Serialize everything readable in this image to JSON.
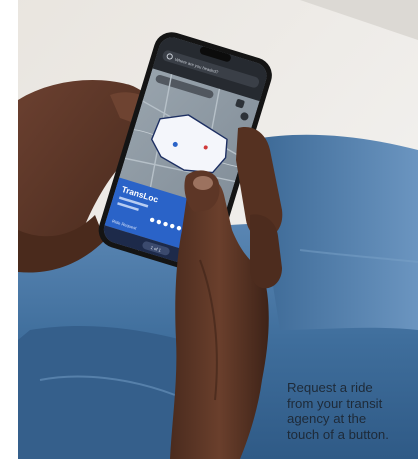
{
  "caption": {
    "line_1": "Request a ride",
    "line_2": "from your transit",
    "line_3": "agency at the",
    "line_4": "touch of a button."
  },
  "phone": {
    "brand_title": "TransLoc",
    "search_hint": "Where are you headed?",
    "footer_hint": "Ride Request",
    "pager": "1 of 1"
  },
  "colors": {
    "wall": "#eceae6",
    "jeans": "#3f6e9c",
    "skin": "#5a3524",
    "phone_body": "#141414",
    "map_bg": "#8e9aa4",
    "service_zone": "#f4f6fb",
    "transloc_blue": "#2a63c8",
    "caption_text": "#1e2a38"
  },
  "icons": {
    "search": "search-icon",
    "map_layers": "map-layers-icon",
    "settings": "gear-icon"
  }
}
